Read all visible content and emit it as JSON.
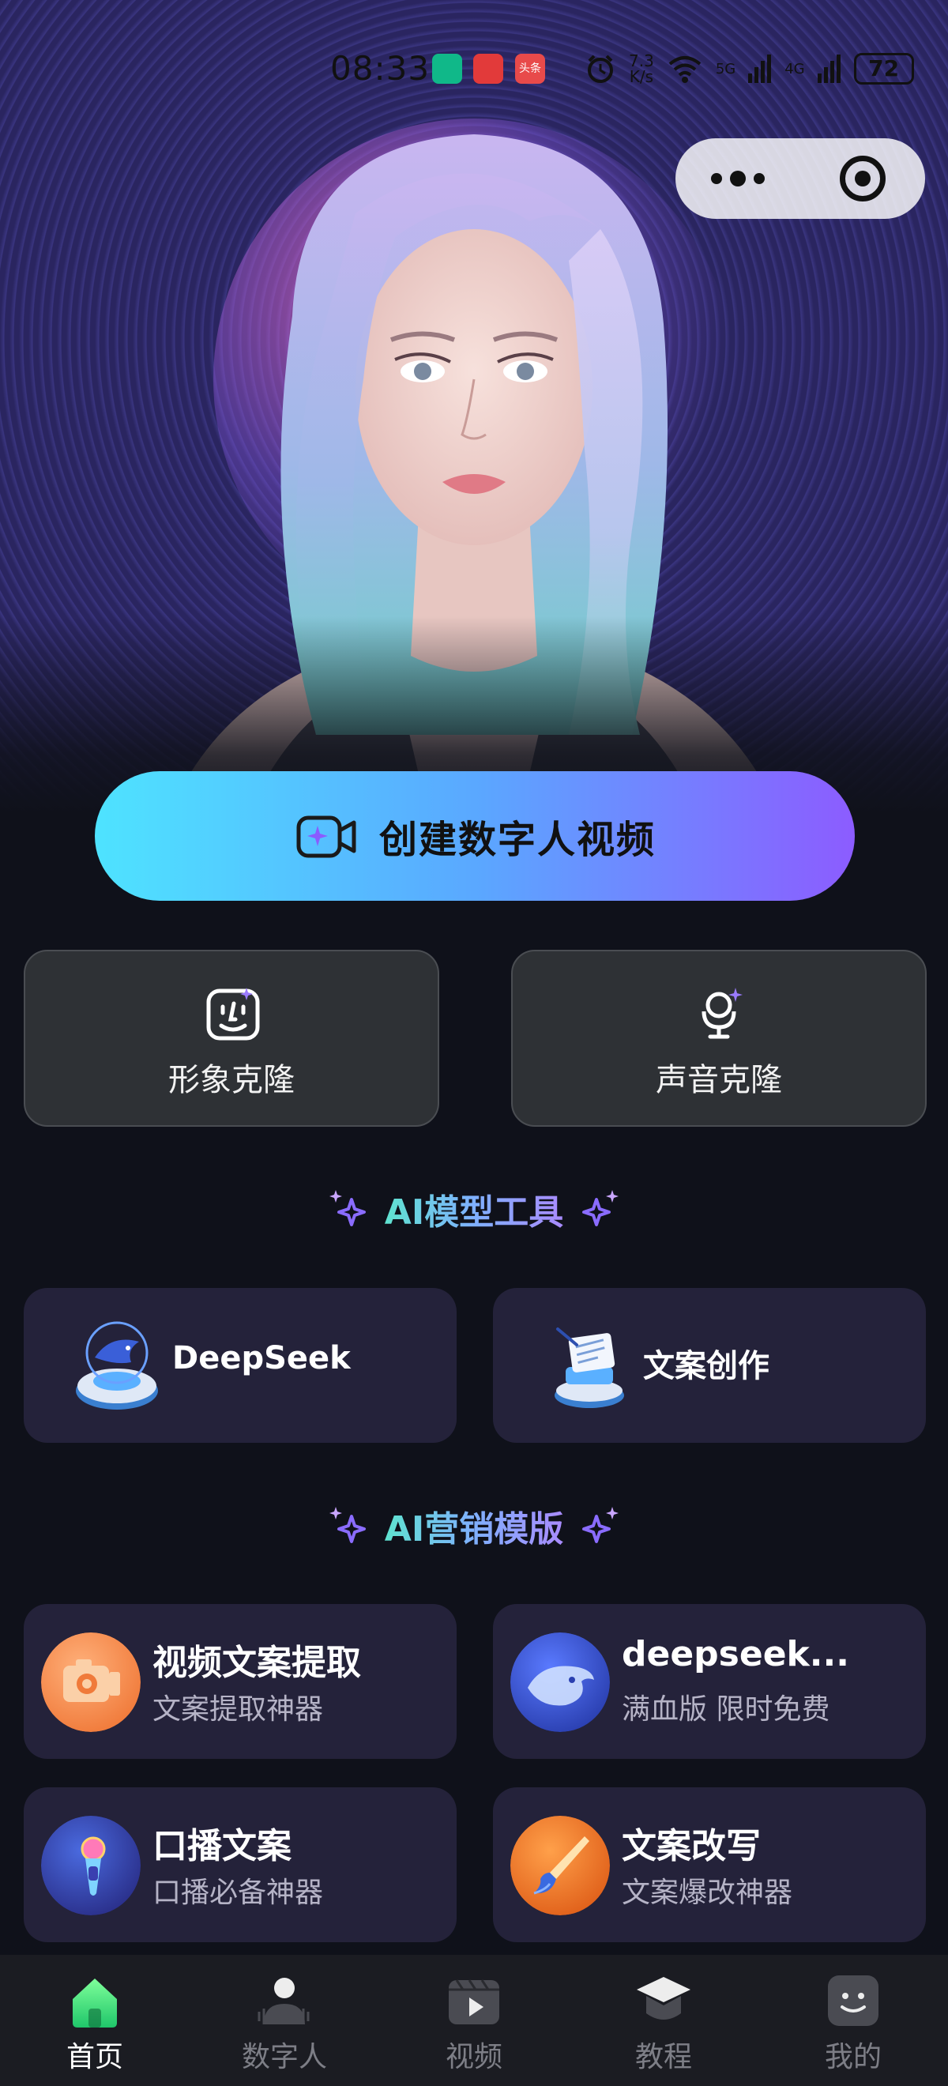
{
  "status_bar": {
    "time": "08:33",
    "app_tt": "头条",
    "net_speed_value": "7.3",
    "net_speed_unit": "K/s",
    "sig_5g": "5G",
    "sig_4g": "4G",
    "battery": "72"
  },
  "create_button": {
    "label": "创建数字人视频"
  },
  "clone": {
    "image": "形象克隆",
    "voice": "声音克隆"
  },
  "sections": {
    "tools": "AI模型工具",
    "templates": "AI营销模版"
  },
  "tools": [
    {
      "label": "DeepSeek"
    },
    {
      "label": "文案创作"
    }
  ],
  "templates": [
    {
      "title": "视频文案提取",
      "subtitle": "文案提取神器"
    },
    {
      "title": "deepseek...",
      "subtitle": "满血版 限时免费"
    },
    {
      "title": "口播文案",
      "subtitle": "口播必备神器"
    },
    {
      "title": "文案改写",
      "subtitle": "文案爆改神器"
    }
  ],
  "nav": [
    {
      "label": "首页",
      "icon": "home-icon",
      "active": true
    },
    {
      "label": "数字人",
      "icon": "digital-human-icon"
    },
    {
      "label": "视频",
      "icon": "video-icon"
    },
    {
      "label": "教程",
      "icon": "tutorial-icon"
    },
    {
      "label": "我的",
      "icon": "profile-icon"
    }
  ],
  "colors": {
    "background": "#0f111a",
    "card": "#24223a",
    "clone_card": "#2e3135",
    "accent_start": "#4ee3ff",
    "accent_end": "#8c5cff",
    "nav_active": "#ffffff",
    "nav_inactive": "#7d7e86"
  }
}
